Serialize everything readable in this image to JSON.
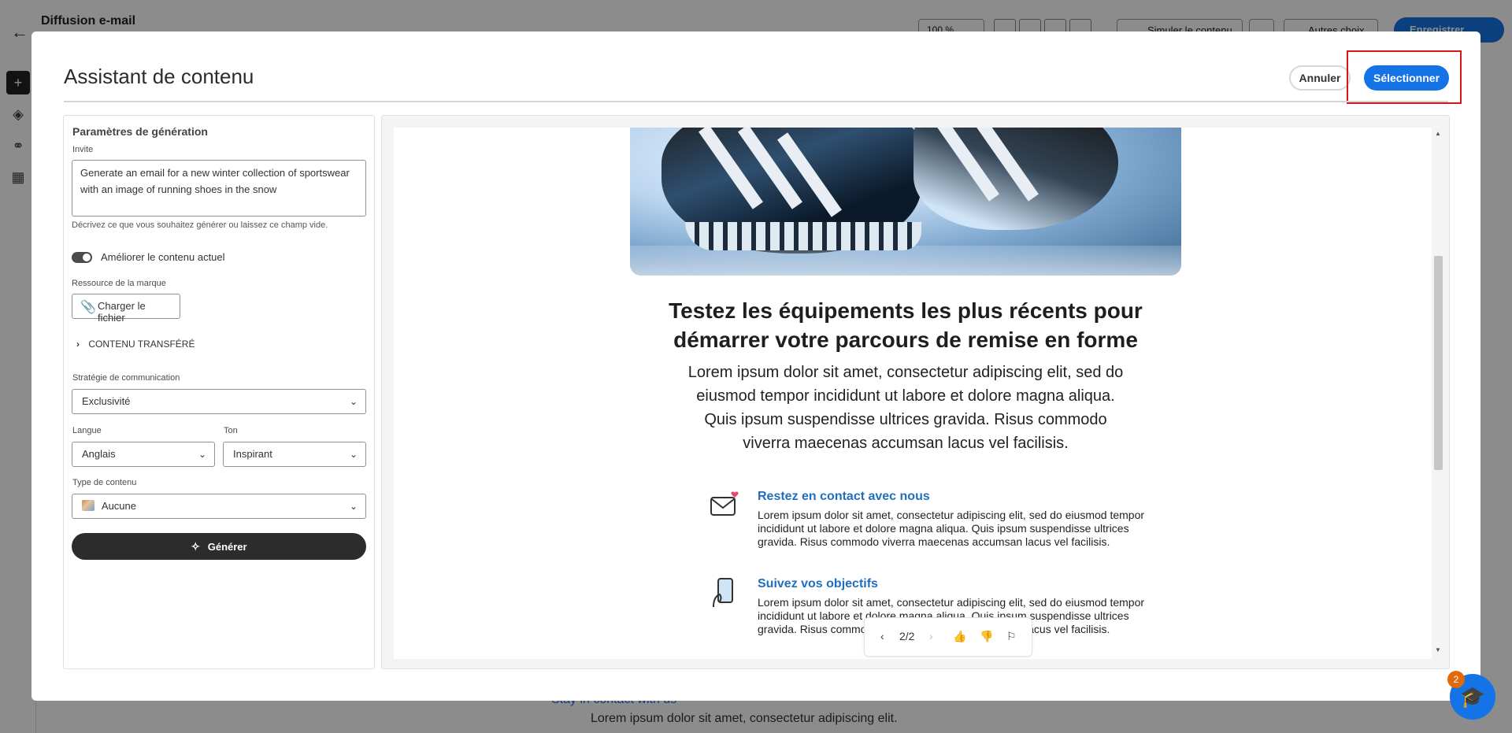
{
  "background": {
    "app_title": "Diffusion e-mail",
    "zoom": "100 %",
    "simulate_label": "Simuler le contenu",
    "other_label": "Autres choix",
    "save_label": "Enregistrer",
    "bottom_link": "Stay in contact with us",
    "bottom_text": "Lorem ipsum dolor sit amet, consectetur adipiscing elit."
  },
  "modal": {
    "title": "Assistant de contenu",
    "cancel_label": "Annuler",
    "select_label": "Sélectionner"
  },
  "generation": {
    "heading": "Paramètres de génération",
    "prompt_label": "Invite",
    "prompt_value": "Generate an email for a new winter collection of sportswear with an image of running shoes in the snow",
    "prompt_help": "Décrivez ce que vous souhaitez générer ou laissez ce champ vide.",
    "improve_label": "Améliorer le contenu actuel",
    "improve_on": true,
    "brand_label": "Ressource de la marque",
    "upload_label": "Charger le fichier",
    "transferred_label": "CONTENU TRANSFÉRÉ",
    "strategy_label": "Stratégie de communication",
    "strategy_value": "Exclusivité",
    "language_label": "Langue",
    "language_value": "Anglais",
    "tone_label": "Ton",
    "tone_value": "Inspirant",
    "content_type_label": "Type de contenu",
    "content_type_value": "Aucune",
    "generate_label": "Générer"
  },
  "preview": {
    "headline": "Testez les équipements les plus récents pour démarrer votre parcours de remise en forme",
    "body": "Lorem ipsum dolor sit amet, consectetur adipiscing elit, sed do eiusmod tempor incididunt ut labore et dolore magna aliqua. Quis ipsum suspendisse ultrices gravida. Risus commodo viverra maecenas accumsan lacus vel facilisis.",
    "features": [
      {
        "title": "Restez en contact avec nous",
        "text": "Lorem ipsum dolor sit amet, consectetur adipiscing elit, sed do eiusmod tempor incididunt ut labore et dolore magna aliqua. Quis ipsum suspendisse ultrices gravida. Risus commodo viverra maecenas accumsan lacus vel facilisis.",
        "icon": "mail-heart-icon"
      },
      {
        "title": "Suivez vos objectifs",
        "text": "Lorem ipsum dolor sit amet, consectetur adipiscing elit, sed do eiusmod tempor incididunt ut labore et dolore magna aliqua. Quis ipsum suspendisse ultrices gravida. Risus commodo viverra maecenas accumsan lacus vel facilisis.",
        "icon": "phone-hand-icon"
      }
    ],
    "page_indicator": "2/2"
  },
  "help": {
    "badge_count": "2"
  },
  "colors": {
    "accent": "#1473e6",
    "highlight": "#d7161c",
    "link": "#1f6fbf"
  }
}
